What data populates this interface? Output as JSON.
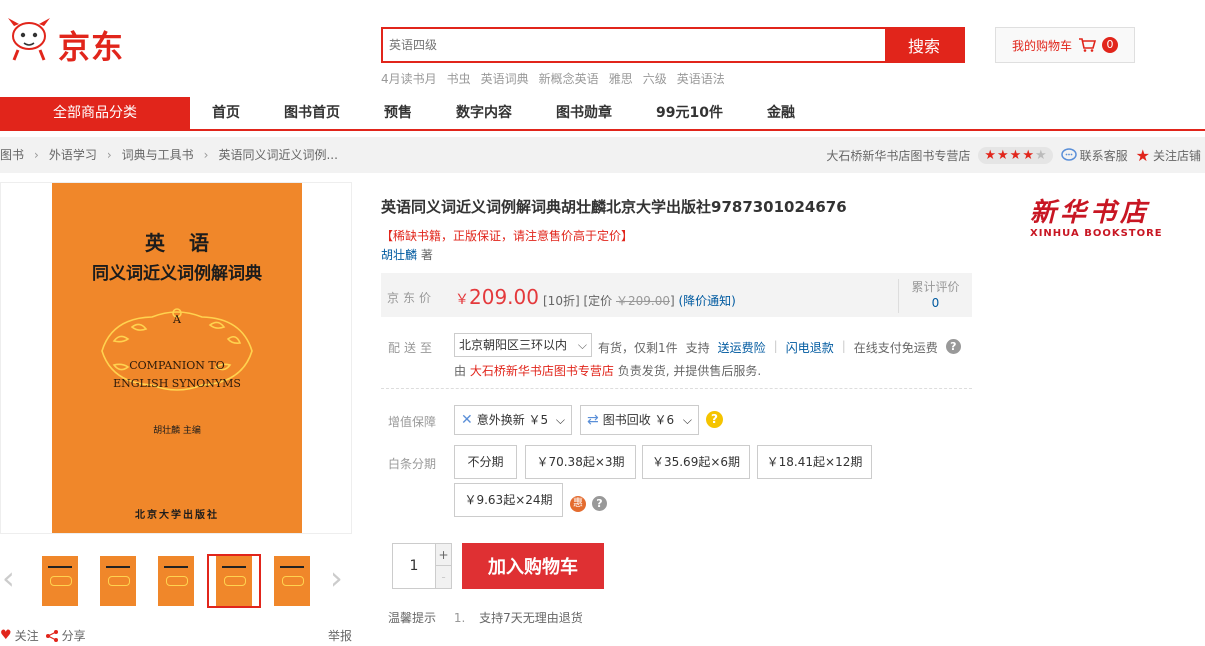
{
  "header": {
    "brand": "京东",
    "search_placeholder": "英语四级",
    "search_button": "搜索",
    "hotwords": [
      "4月读书月",
      "书虫",
      "英语词典",
      "新概念英语",
      "雅思",
      "六级",
      "英语语法"
    ],
    "cart_label": "我的购物车",
    "cart_count": "0"
  },
  "nav": {
    "all_categories": "全部商品分类",
    "items": [
      "首页",
      "图书首页",
      "预售",
      "数字内容",
      "图书勋章",
      "99元10件",
      "金融"
    ]
  },
  "breadcrumb": [
    "图书",
    "外语学习",
    "词典与工具书",
    "英语同义词近义词例..."
  ],
  "shop": {
    "name": "大石桥新华书店图书专营店",
    "rating_stars": 4,
    "contact": "联系客服",
    "follow": "关注店铺"
  },
  "cover": {
    "title_line1": "英语",
    "title_line2": "同义词近义词例解词典",
    "en_a": "A",
    "en_line1": "COMPANION TO",
    "en_line2": "ENGLISH SYNONYMS",
    "author": "胡壮麟  主编",
    "publisher": "北京大学出版社"
  },
  "gallery": {
    "thumb_count": 5,
    "active_index": 3,
    "follow_label": "关注",
    "share_label": "分享",
    "report_label": "举报"
  },
  "product": {
    "title": "英语同义词近义词例解词典胡壮麟北京大学出版社9787301024676",
    "promo": "【稀缺书籍，正版保证，请注意售价高于定价】",
    "author_name": "胡壮麟",
    "author_suffix": "著",
    "store_logo_cn": "新华书店",
    "store_logo_en": "XINHUA  BOOKSTORE"
  },
  "price": {
    "label": "京东价",
    "currency": "￥",
    "value": "209.00",
    "discount": "[10折]",
    "list_label": "[定价",
    "list_price": "￥209.00",
    "list_close": "]",
    "notify": "(降价通知)",
    "review_label": "累计评价",
    "review_count": "0"
  },
  "delivery": {
    "label": "配送至",
    "region": "北京朝阳区三环以内",
    "stock": "有货，仅剩1件",
    "support": "支持",
    "freight_link": "送运费险",
    "refund_link": "闪电退款",
    "free_ship": "在线支付免运费",
    "ship_prefix": "由",
    "ship_store": "大石桥新华书店图书专营店",
    "ship_suffix": "负责发货, 并提供售后服务."
  },
  "services": {
    "label": "增值保障",
    "opt1": "意外换新 ￥5",
    "opt2": "图书回收 ￥6"
  },
  "installment": {
    "label": "白条分期",
    "options": [
      "不分期",
      "￥70.38起×3期",
      "￥35.69起×6期",
      "￥18.41起×12期",
      "￥9.63起×24期"
    ]
  },
  "buy": {
    "quantity": "1",
    "add_to_cart": "加入购物车"
  },
  "tips": {
    "label": "温馨提示",
    "items": [
      "支持7天无理由退货"
    ]
  },
  "colors": {
    "jd_red": "#e1251b",
    "price_red": "#e4393c",
    "link_blue": "#005aa0",
    "cover_orange": "#f0872a"
  }
}
